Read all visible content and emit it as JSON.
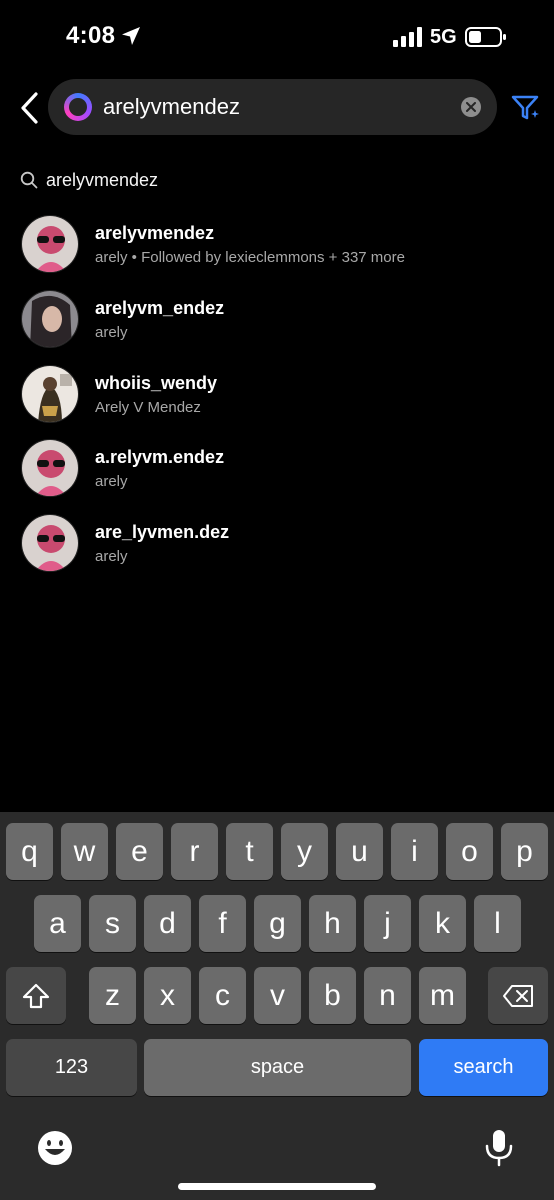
{
  "status": {
    "time": "4:08",
    "network": "5G"
  },
  "search": {
    "query": "arelyvmendez"
  },
  "suggestion": {
    "text": "arelyvmendez"
  },
  "results": [
    {
      "username": "arelyvmendez",
      "subtitle": "arely • Followed by lexieclemmons + 337 more"
    },
    {
      "username": "arelyvm_endez",
      "subtitle": "arely"
    },
    {
      "username": "whoiis_wendy",
      "subtitle": "Arely V Mendez"
    },
    {
      "username": "a.relyvm.endez",
      "subtitle": "arely"
    },
    {
      "username": "are_lyvmen.dez",
      "subtitle": "arely"
    }
  ],
  "keyboard": {
    "row1": [
      "q",
      "w",
      "e",
      "r",
      "t",
      "y",
      "u",
      "i",
      "o",
      "p"
    ],
    "row2": [
      "a",
      "s",
      "d",
      "f",
      "g",
      "h",
      "j",
      "k",
      "l"
    ],
    "row3": [
      "z",
      "x",
      "c",
      "v",
      "b",
      "n",
      "m"
    ],
    "numbers_label": "123",
    "space_label": "space",
    "search_label": "search"
  },
  "colors": {
    "accent": "#2f7bf5",
    "background": "#000000",
    "field": "#262626",
    "key": "#6b6b6b"
  }
}
